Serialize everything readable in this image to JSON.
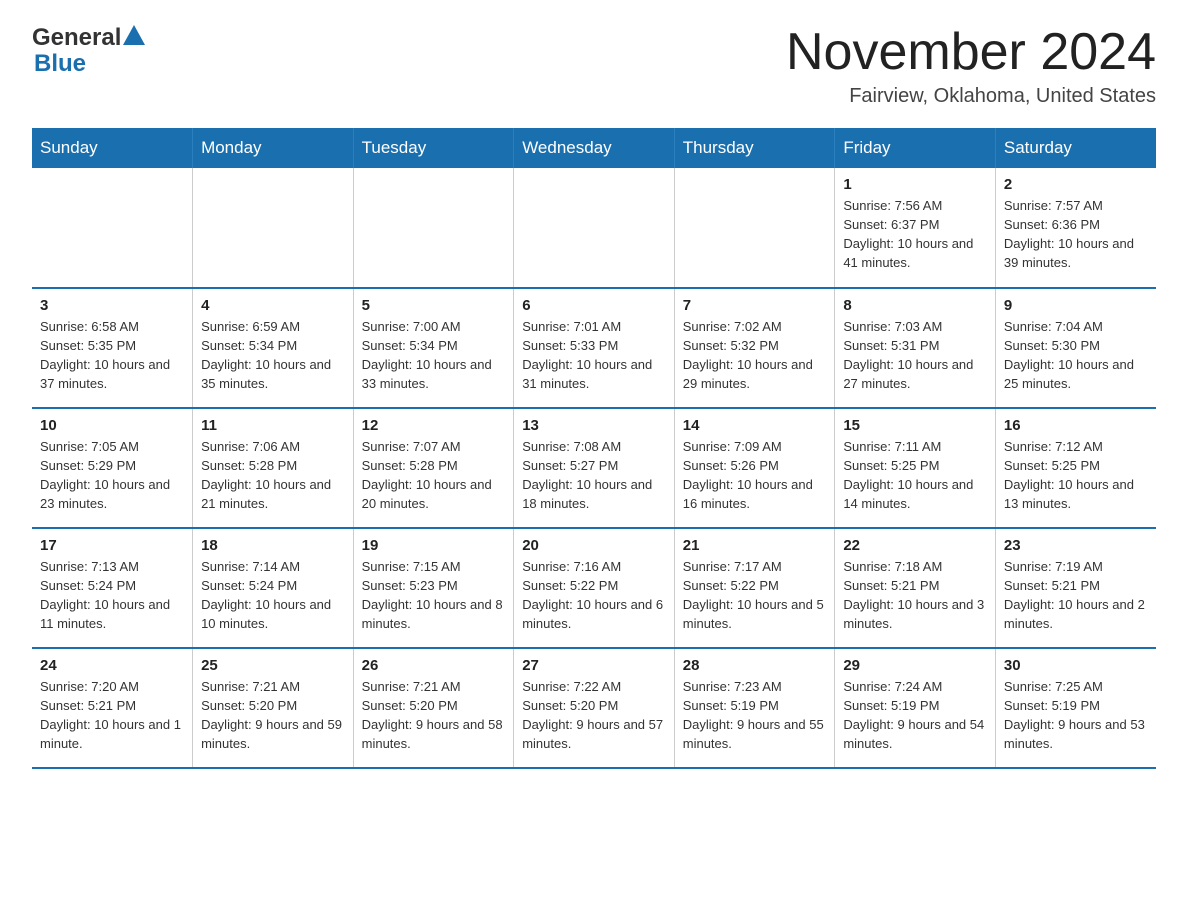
{
  "logo": {
    "general": "General",
    "blue": "Blue",
    "arrow_color": "#1a6faf"
  },
  "title": "November 2024",
  "subtitle": "Fairview, Oklahoma, United States",
  "days_of_week": [
    "Sunday",
    "Monday",
    "Tuesday",
    "Wednesday",
    "Thursday",
    "Friday",
    "Saturday"
  ],
  "weeks": [
    [
      {
        "day": "",
        "info": ""
      },
      {
        "day": "",
        "info": ""
      },
      {
        "day": "",
        "info": ""
      },
      {
        "day": "",
        "info": ""
      },
      {
        "day": "",
        "info": ""
      },
      {
        "day": "1",
        "info": "Sunrise: 7:56 AM\nSunset: 6:37 PM\nDaylight: 10 hours and 41 minutes."
      },
      {
        "day": "2",
        "info": "Sunrise: 7:57 AM\nSunset: 6:36 PM\nDaylight: 10 hours and 39 minutes."
      }
    ],
    [
      {
        "day": "3",
        "info": "Sunrise: 6:58 AM\nSunset: 5:35 PM\nDaylight: 10 hours and 37 minutes."
      },
      {
        "day": "4",
        "info": "Sunrise: 6:59 AM\nSunset: 5:34 PM\nDaylight: 10 hours and 35 minutes."
      },
      {
        "day": "5",
        "info": "Sunrise: 7:00 AM\nSunset: 5:34 PM\nDaylight: 10 hours and 33 minutes."
      },
      {
        "day": "6",
        "info": "Sunrise: 7:01 AM\nSunset: 5:33 PM\nDaylight: 10 hours and 31 minutes."
      },
      {
        "day": "7",
        "info": "Sunrise: 7:02 AM\nSunset: 5:32 PM\nDaylight: 10 hours and 29 minutes."
      },
      {
        "day": "8",
        "info": "Sunrise: 7:03 AM\nSunset: 5:31 PM\nDaylight: 10 hours and 27 minutes."
      },
      {
        "day": "9",
        "info": "Sunrise: 7:04 AM\nSunset: 5:30 PM\nDaylight: 10 hours and 25 minutes."
      }
    ],
    [
      {
        "day": "10",
        "info": "Sunrise: 7:05 AM\nSunset: 5:29 PM\nDaylight: 10 hours and 23 minutes."
      },
      {
        "day": "11",
        "info": "Sunrise: 7:06 AM\nSunset: 5:28 PM\nDaylight: 10 hours and 21 minutes."
      },
      {
        "day": "12",
        "info": "Sunrise: 7:07 AM\nSunset: 5:28 PM\nDaylight: 10 hours and 20 minutes."
      },
      {
        "day": "13",
        "info": "Sunrise: 7:08 AM\nSunset: 5:27 PM\nDaylight: 10 hours and 18 minutes."
      },
      {
        "day": "14",
        "info": "Sunrise: 7:09 AM\nSunset: 5:26 PM\nDaylight: 10 hours and 16 minutes."
      },
      {
        "day": "15",
        "info": "Sunrise: 7:11 AM\nSunset: 5:25 PM\nDaylight: 10 hours and 14 minutes."
      },
      {
        "day": "16",
        "info": "Sunrise: 7:12 AM\nSunset: 5:25 PM\nDaylight: 10 hours and 13 minutes."
      }
    ],
    [
      {
        "day": "17",
        "info": "Sunrise: 7:13 AM\nSunset: 5:24 PM\nDaylight: 10 hours and 11 minutes."
      },
      {
        "day": "18",
        "info": "Sunrise: 7:14 AM\nSunset: 5:24 PM\nDaylight: 10 hours and 10 minutes."
      },
      {
        "day": "19",
        "info": "Sunrise: 7:15 AM\nSunset: 5:23 PM\nDaylight: 10 hours and 8 minutes."
      },
      {
        "day": "20",
        "info": "Sunrise: 7:16 AM\nSunset: 5:22 PM\nDaylight: 10 hours and 6 minutes."
      },
      {
        "day": "21",
        "info": "Sunrise: 7:17 AM\nSunset: 5:22 PM\nDaylight: 10 hours and 5 minutes."
      },
      {
        "day": "22",
        "info": "Sunrise: 7:18 AM\nSunset: 5:21 PM\nDaylight: 10 hours and 3 minutes."
      },
      {
        "day": "23",
        "info": "Sunrise: 7:19 AM\nSunset: 5:21 PM\nDaylight: 10 hours and 2 minutes."
      }
    ],
    [
      {
        "day": "24",
        "info": "Sunrise: 7:20 AM\nSunset: 5:21 PM\nDaylight: 10 hours and 1 minute."
      },
      {
        "day": "25",
        "info": "Sunrise: 7:21 AM\nSunset: 5:20 PM\nDaylight: 9 hours and 59 minutes."
      },
      {
        "day": "26",
        "info": "Sunrise: 7:21 AM\nSunset: 5:20 PM\nDaylight: 9 hours and 58 minutes."
      },
      {
        "day": "27",
        "info": "Sunrise: 7:22 AM\nSunset: 5:20 PM\nDaylight: 9 hours and 57 minutes."
      },
      {
        "day": "28",
        "info": "Sunrise: 7:23 AM\nSunset: 5:19 PM\nDaylight: 9 hours and 55 minutes."
      },
      {
        "day": "29",
        "info": "Sunrise: 7:24 AM\nSunset: 5:19 PM\nDaylight: 9 hours and 54 minutes."
      },
      {
        "day": "30",
        "info": "Sunrise: 7:25 AM\nSunset: 5:19 PM\nDaylight: 9 hours and 53 minutes."
      }
    ]
  ]
}
